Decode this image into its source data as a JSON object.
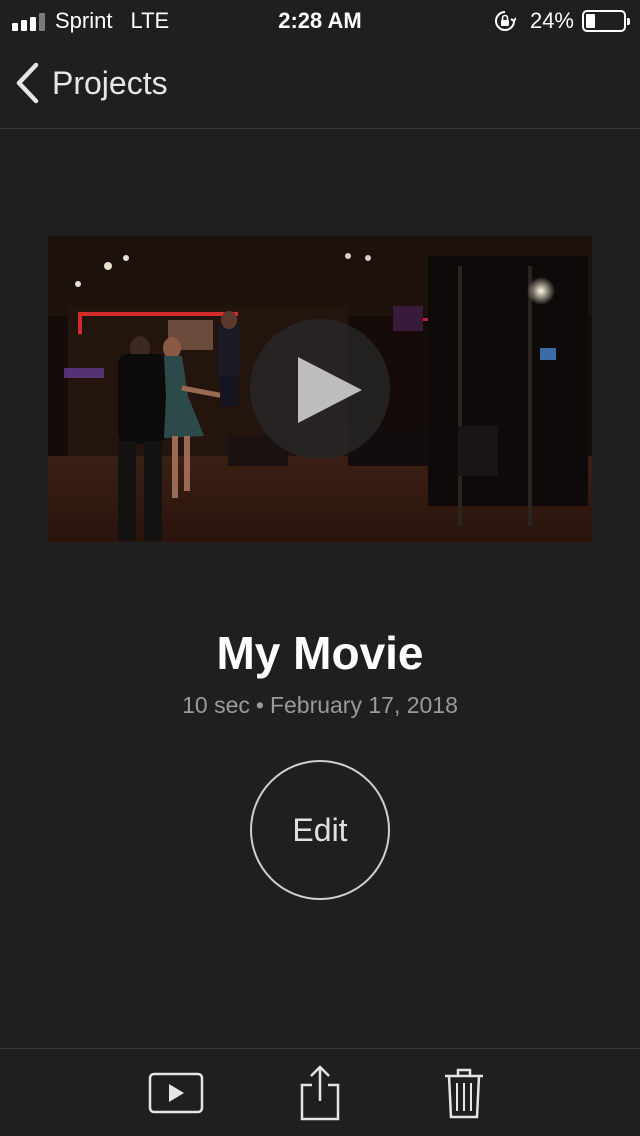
{
  "status_bar": {
    "carrier": "Sprint",
    "network": "LTE",
    "time": "2:28 AM",
    "battery_percent": "24%",
    "battery_level": 0.24
  },
  "nav": {
    "back_label": "Projects"
  },
  "project": {
    "title": "My Movie",
    "duration": "10 sec",
    "separator": "•",
    "date": "February 17, 2018"
  },
  "actions": {
    "edit_label": "Edit"
  },
  "toolbar": {
    "icons": [
      "play-icon",
      "share-icon",
      "trash-icon"
    ]
  },
  "colors": {
    "background": "#1f1f1f",
    "divider": "#3a3a3a",
    "meta_text": "#9a9a9a"
  }
}
